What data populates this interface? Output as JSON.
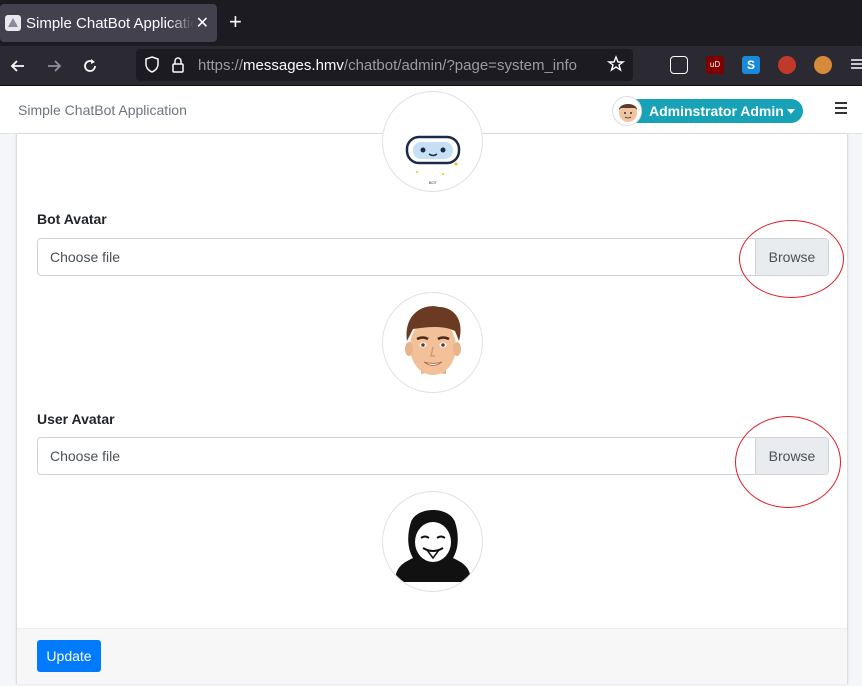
{
  "browser": {
    "tab_title": "Simple ChatBot Application",
    "close_glyph": "✕",
    "new_tab_glyph": "+",
    "url_scheme": "https://",
    "url_host": "messages.hmv",
    "url_path": "/chatbot/admin/?page=system_info",
    "ext_ublock": "uD",
    "ext_s": "S"
  },
  "header": {
    "app_title": "Simple ChatBot Application",
    "user_name": "Adminstrator Admin"
  },
  "form": {
    "bot_avatar_label": "Bot Avatar",
    "bot_file_placeholder": "Choose file",
    "bot_browse_label": "Browse",
    "user_avatar_label": "User Avatar",
    "user_file_placeholder": "Choose file",
    "user_browse_label": "Browse",
    "update_label": "Update"
  },
  "bot_logo_text": "BOT",
  "colors": {
    "accent_pill": "#17a2b8",
    "primary_button": "#007bff",
    "annotation": "#e01b24"
  }
}
